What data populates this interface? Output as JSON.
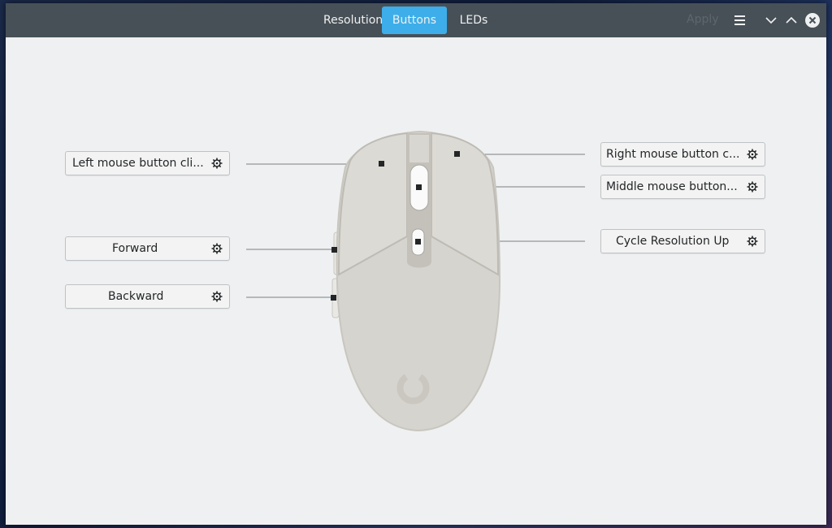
{
  "header": {
    "tabs": [
      {
        "label": "Resolutions",
        "active": false
      },
      {
        "label": "Buttons",
        "active": true
      },
      {
        "label": "LEDs",
        "active": false
      }
    ],
    "apply_label": "Apply",
    "icons": [
      "menu-icon",
      "minimize-icon",
      "maximize-icon",
      "close-icon"
    ]
  },
  "buttons": {
    "left": [
      {
        "label": "Left mouse button cli..."
      },
      {
        "label": "Forward"
      },
      {
        "label": "Backward"
      }
    ],
    "right": [
      {
        "label": "Right mouse button c..."
      },
      {
        "label": "Middle mouse button..."
      },
      {
        "label": "Cycle Resolution Up"
      }
    ]
  },
  "colors": {
    "accent": "#3daee9",
    "header_bg": "#475057",
    "window_bg": "#eff0f1",
    "mouse_body": "#d7d5cf"
  }
}
